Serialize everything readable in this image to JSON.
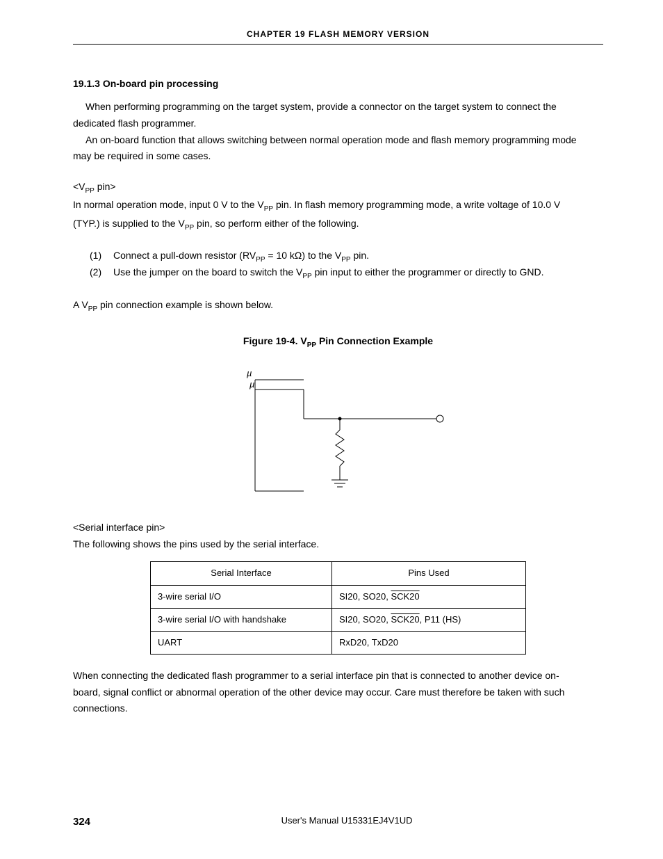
{
  "chapterHeader": "CHAPTER  19   FLASH  MEMORY  VERSION",
  "section": {
    "number": "19.1.3",
    "title": "On-board pin processing"
  },
  "para1a": "When performing programming on the target system, provide a connector on the target system to connect the",
  "para1b": "dedicated flash programmer.",
  "para2a": "An on-board function that allows switching between normal operation mode and flash memory programming mode",
  "para2b": "may be required in some cases.",
  "vpp": {
    "label_open": "<V",
    "label_close": " pin>",
    "sub": "PP",
    "line1a": "In normal operation mode, input 0 V to the V",
    "line1b": " pin. In flash memory programming mode, a write voltage of 10.0 V",
    "line2a": "(TYP.) is supplied to the V",
    "line2b": " pin, so perform either of the following.",
    "item1_num": "(1)",
    "item1a": "Connect a pull-down resistor (RV",
    "item1b": " = 10 kΩ) to the V",
    "item1c": " pin.",
    "item2_num": "(2)",
    "item2a": "Use the jumper on the board to switch the V",
    "item2b": " pin input to either the programmer or directly to GND.",
    "example_a": "A V",
    "example_b": " pin connection example is shown below."
  },
  "figure": {
    "caption_pre": "Figure 19-4.  V",
    "caption_post": " Pin Connection Example",
    "mu1": "µ",
    "mu2": "µ"
  },
  "serialPin": {
    "label": "<Serial interface pin>",
    "intro": "The following shows the pins used by the serial interface."
  },
  "table": {
    "head1": "Serial Interface",
    "head2": "Pins Used",
    "rows": [
      {
        "if": "3-wire serial I/O",
        "pins_pre": "SI20, SO20, ",
        "pins_over": "SCK20",
        "pins_post": ""
      },
      {
        "if": "3-wire serial I/O with handshake",
        "pins_pre": "SI20, SO20, ",
        "pins_over": "SCK20",
        "pins_post": ", P11 (HS)"
      },
      {
        "if": "UART",
        "pins_pre": "RxD20, TxD20",
        "pins_over": "",
        "pins_post": ""
      }
    ]
  },
  "caution1": "When connecting the dedicated flash programmer to a serial interface pin that is connected to another device on-",
  "caution2": "board, signal conflict or abnormal operation of the other device may occur. Care must therefore be taken with such",
  "caution3": "connections.",
  "footer": {
    "pageNum": "324",
    "manual": "User's Manual  U15331EJ4V1UD"
  }
}
